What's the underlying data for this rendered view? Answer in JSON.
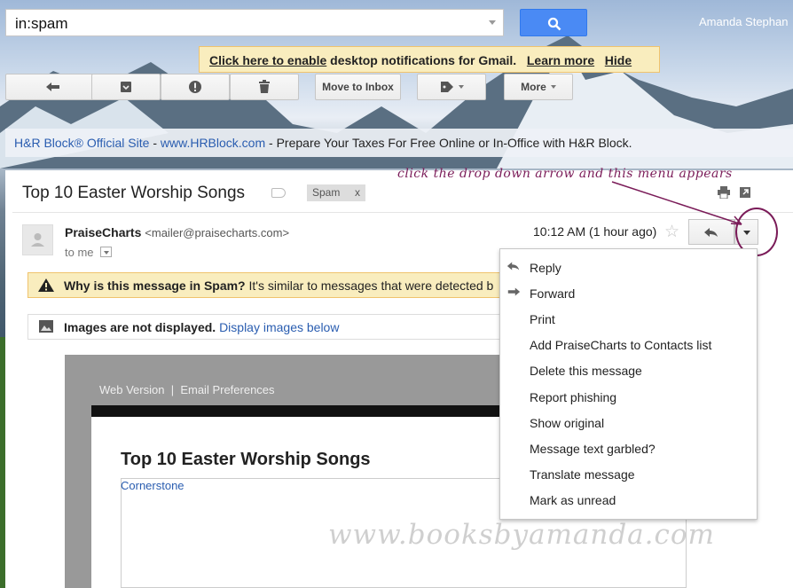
{
  "search": {
    "query": "in:spam"
  },
  "user": {
    "name": "Amanda Stephan"
  },
  "notification": {
    "enable_link": "Click here to enable",
    "message": "desktop notifications for Gmail.",
    "learn_more": "Learn more",
    "hide": "Hide"
  },
  "toolbar": {
    "move_to_inbox": "Move to Inbox",
    "more": "More"
  },
  "ad": {
    "title": "H&R Block® Official Site",
    "separator": " - ",
    "url": "www.HRBlock.com",
    "text": " - Prepare Your Taxes For Free Online or In-Office with H&R Block."
  },
  "message": {
    "subject": "Top 10 Easter Worship Songs",
    "spam_label": "Spam",
    "spam_label_close": "x",
    "sender_name": "PraiseCharts",
    "sender_email": "<mailer@praisecharts.com>",
    "to": "to me",
    "time": "10:12 AM (1 hour ago)",
    "spam_warning_title": "Why is this message in Spam?",
    "spam_warning_text": " It's similar to messages that were detected b",
    "images_note": "Images are not displayed.",
    "display_images": "Display images below"
  },
  "annotation": {
    "note": "click the drop down arrow and this menu appears"
  },
  "email_body": {
    "web_version": "Web Version",
    "sep": "|",
    "email_prefs": "Email Preferences",
    "title": "Top 10 Easter Worship Songs",
    "link": "Cornerstone",
    "watermark": "www.booksbyamanda.com"
  },
  "menu": {
    "items": [
      {
        "label": "Reply",
        "icon": "reply-icon"
      },
      {
        "label": "Forward",
        "icon": "forward-icon"
      },
      {
        "label": "Print"
      },
      {
        "label": "Add PraiseCharts to Contacts list"
      },
      {
        "label": "Delete this message"
      },
      {
        "label": "Report phishing"
      },
      {
        "label": "Show original"
      },
      {
        "label": "Message text garbled?"
      },
      {
        "label": "Translate message"
      },
      {
        "label": "Mark as unread"
      }
    ]
  }
}
